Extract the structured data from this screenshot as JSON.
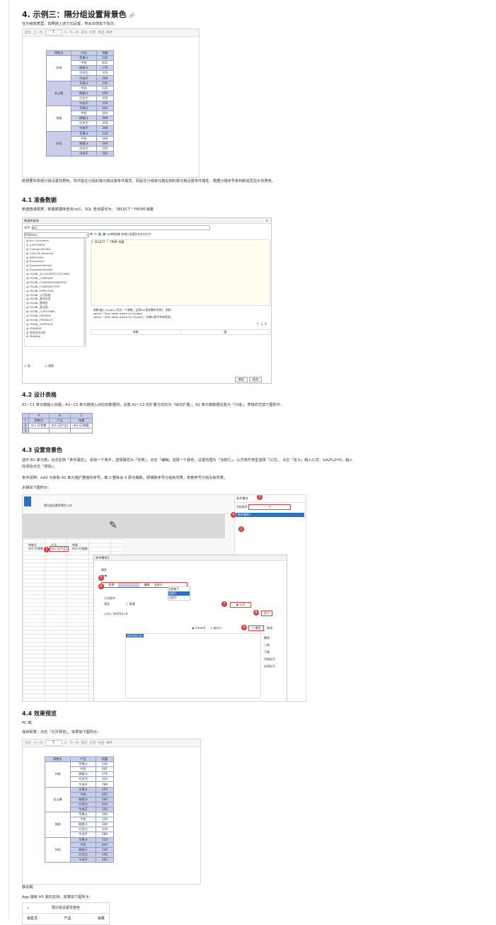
{
  "heading_example3": "4. 示例三：隔分组设置背景色",
  "intro": "在分组报表里，如果按上述方式设置，将会出现如下情况：",
  "toolbar": {
    "first": "首页",
    "prev": "上一页",
    "page": "1",
    "total": "/1",
    "next": "下一页",
    "last": "末页",
    "print": "打印",
    "export": "导出",
    "mail": "邮件"
  },
  "report_headers": [
    "销售员",
    "产品",
    "销量"
  ],
  "report1": [
    {
      "name": "孙林",
      "rows": [
        [
          "苹果汁",
          "140"
        ],
        [
          "牛奶",
          "631"
        ],
        [
          "柳橙汁",
          "176"
        ],
        [
          "巧克力",
          "333"
        ],
        [
          "牛肉干",
          "289"
        ]
      ]
    },
    {
      "name": "金士鹏",
      "rows": [
        [
          "苹果汁",
          "250"
        ],
        [
          "牛奶",
          "535"
        ],
        [
          "柳橙汁",
          "500"
        ],
        [
          "巧克力",
          "420"
        ],
        [
          "牛肉干",
          "156"
        ]
      ]
    },
    {
      "name": "张颖",
      "rows": [
        [
          "苹果汁",
          "300"
        ],
        [
          "牛奶",
          "304"
        ],
        [
          "柳橙汁",
          "380"
        ],
        [
          "巧克力",
          "318"
        ],
        [
          "牛肉干",
          "389"
        ]
      ]
    },
    {
      "name": "孙阳",
      "rows": [
        [
          "苹果汁",
          "120"
        ],
        [
          "牛奶",
          "546"
        ],
        [
          "柳橙汁",
          "540"
        ],
        [
          "巧克力",
          "255"
        ],
        [
          "牛肉干",
          "562"
        ]
      ]
    }
  ],
  "desc1": "若想要实现按分组设置背景色，则不能在分组的单元格设置条件属性，而是在分组单元格右侧的单元格设置条件属性，根据分组序号来判断是否显示背景色。",
  "h_prepare": "4.1 准备数据",
  "prepare_text": "新建普通报表，新建数据库查询 ds1，SQL 查询语句为：  SELECT * FROM 销量",
  "dialog": {
    "title": "数据库查询",
    "name_label": "名字:",
    "name_value": "ds1",
    "db": "FRDemo",
    "sql": "1  SELECT * FROM 销量",
    "options": "从单数据集   新增记录缓存存在向后中",
    "tables": [
      "Acc_Accidents",
      "CUSTOMER",
      "CompanyProfits",
      "Cost_VS_Revenue",
      "EMPLOYEE",
      "Equipment",
      "EquipmentDetail",
      "EquipmentUsage",
      "FDUBL_ACCOUNTSCUSTOMER",
      "FDUBL_COMPANY",
      "FDUBL_COMPANYDISBURSE",
      "FDUBL_COMPANYTYPE",
      "FDUBL_EMPLOYEE",
      "FDUBL_公司采购",
      "FDUBL_基本信息",
      "FDUBL_客服合",
      "FDUBL_登记表",
      "FDUBL_CUSTOMER",
      "FDUBL_ORDERS",
      "FDUBL_PRODUCT",
      "FDUBL_SUPPLIER",
      "FRANDIS",
      "现场活动分析",
      "SiteMap"
    ],
    "check_table": "表",
    "check_view": "视图",
    "hint1": "参数(键入'${abc}'作为一个参数，这是abc是参数的名称)：例如：",
    "hint2": "select * from table where id=${abc}",
    "hint3": "select * from table where id='${abc}'  (如果id是字符串类型)",
    "col_param": "参数",
    "col_value": "值",
    "ok": "确定",
    "cancel": "取消"
  },
  "h_design": "4.2 设计表格",
  "design_text": "A1~C1 单元格输入标题，A2~C2 单元格拖入对应的数据列，设置 A2~C2 的扩展方向均为「纵向扩展」，A2 单元格数据设置为「分组」。表格样式如下图所示：",
  "design_table": {
    "cols": [
      "A",
      "B",
      "C"
    ],
    "rows": [
      "1",
      "2",
      "3"
    ],
    "r1": [
      "销售员",
      "产品",
      "销量"
    ],
    "r2": [
      "ds1.G(销售",
      "ds1.G(产品)",
      "ds1.G(销量)"
    ]
  },
  "h_bg": "4.3 设置背景色",
  "bg_text1": "选中 B2 单元格，点击右侧「条件属性」，添加一个条件，选择属性为「背景」，点击「编辑」选择一个颜色，设置范围为「当前行」，公式条件类型选择「公式」，点击「定义」输入公式：&A2%2=0，输入",
  "bg_text1b": "完成后点击「增加」。",
  "bg_text2": "条件说明：&A2 为获取 A2 单元格扩展值的序号，被 2 整除余 0 即为偶数。即偶数序号分组有背景，奇数序号分组没有背景。",
  "bg_text3": "步骤如下图所示：",
  "designer": {
    "tab": "隔分组设置背景色.cpt",
    "panel_title": "条件属性",
    "add_label": "添加条件",
    "cond_item": "条件属性1",
    "dialog_title": "条件属性1",
    "attr": "属性",
    "bg": "背景",
    "edit": "编辑",
    "scope": "当前行",
    "scope_opts": [
      "当前格子",
      "当前行",
      "当前列"
    ],
    "formula_cond": "公式条件",
    "type": "类型",
    "normal": "普通",
    "formula": "公式",
    "formula_label": "公式=",
    "formula_value": "&A2%2=0",
    "define": "定义",
    "and": "与(and)",
    "or": "或(or)",
    "add": "增加",
    "modify": "修改",
    "del": "删除",
    "up": "上移",
    "down": "下移",
    "addbr": "添加括号",
    "rmbr": "去掉括号",
    "result": "&A2%2=0",
    "cells": {
      "a2": "ds1.G(销售",
      "b2": "ds1.G(产品)",
      "c2": "ds1.G(销量)",
      "a1": "销售员",
      "b1": "产品",
      "c1": "销量"
    }
  },
  "h_preview": "4.4 效果预览",
  "pc": "PC 端",
  "pc_text": "保存报表，点击「分页预览」，效果如下图所示：",
  "report2": [
    {
      "name": "孙林",
      "bg": "w",
      "rows": [
        [
          "苹果汁",
          "140"
        ],
        [
          "牛奶",
          "601"
        ],
        [
          "柳橙汁",
          "176"
        ],
        [
          "巧克力",
          "333"
        ],
        [
          "牛肉干",
          "789"
        ]
      ]
    },
    {
      "name": "金士鹏",
      "bg": "g",
      "rows": [
        [
          "苹果汁",
          "250"
        ],
        [
          "牛奶",
          "635"
        ],
        [
          "柳橙汁",
          "500"
        ],
        [
          "巧克力",
          "420"
        ],
        [
          "牛肉干",
          "156"
        ]
      ]
    },
    {
      "name": "张颖",
      "bg": "w",
      "rows": [
        [
          "苹果汁",
          "300"
        ],
        [
          "牛奶",
          "334"
        ],
        [
          "柳橙汁",
          "340"
        ],
        [
          "巧克力",
          "318"
        ],
        [
          "牛肉干",
          "289"
        ]
      ]
    },
    {
      "name": "孙阳",
      "bg": "g",
      "rows": [
        [
          "苹果汁",
          "120"
        ],
        [
          "牛奶",
          "644"
        ],
        [
          "柳橙汁",
          "540"
        ],
        [
          "巧克力",
          "295"
        ],
        [
          "牛肉干",
          "562"
        ]
      ]
    }
  ],
  "mobile": "移动端",
  "mobile_text": "App 端和 H5 端均支持，效果如下图所示：",
  "mobile_title": "隔分组设置背景色",
  "mobile_headers": [
    "销售员",
    "产品",
    "销量"
  ]
}
